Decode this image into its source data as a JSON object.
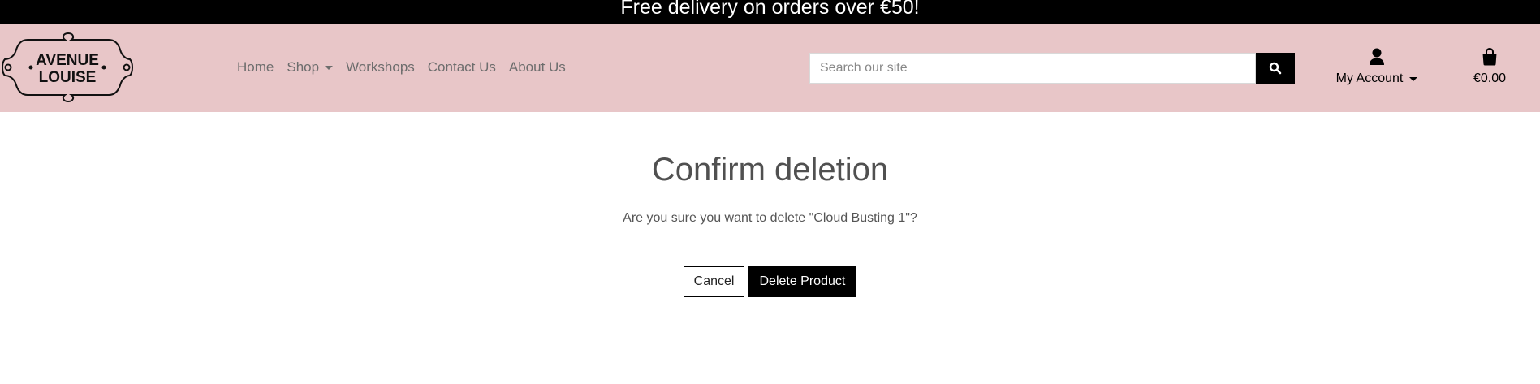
{
  "banner": {
    "text": "Free delivery on orders over €50!"
  },
  "logo": {
    "line1": "AVENUE",
    "line2": "LOUISE"
  },
  "nav": {
    "home": "Home",
    "shop": "Shop",
    "workshops": "Workshops",
    "contact": "Contact Us",
    "about": "About Us"
  },
  "search": {
    "placeholder": "Search our site",
    "value": "",
    "icon": "search-icon"
  },
  "account": {
    "label": "My Account",
    "icon": "user-icon"
  },
  "bag": {
    "total": "€0.00",
    "icon": "shopping-bag-icon"
  },
  "page": {
    "title": "Confirm deletion",
    "message": "Are you sure you want to delete \"Cloud Busting 1\"?",
    "cancel_label": "Cancel",
    "delete_label": "Delete Product"
  },
  "colors": {
    "banner_bg": "#000000",
    "header_bg": "#e8c6c8",
    "button_dark": "#000000"
  }
}
